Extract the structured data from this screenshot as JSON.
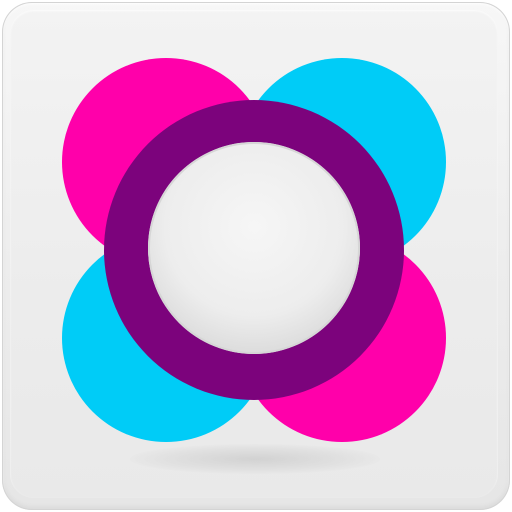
{
  "app_icon": {
    "icon": "overlapping-rings-logo-icon",
    "colors": {
      "tile_light": "#f3f3f3",
      "tile_edge": "#d4d4d4",
      "magenta": "#ff00aa",
      "cyan": "#00ccf7",
      "violet": "#b026ee",
      "dark_purple": "#7c037c",
      "center": "#f2f2f2"
    }
  }
}
